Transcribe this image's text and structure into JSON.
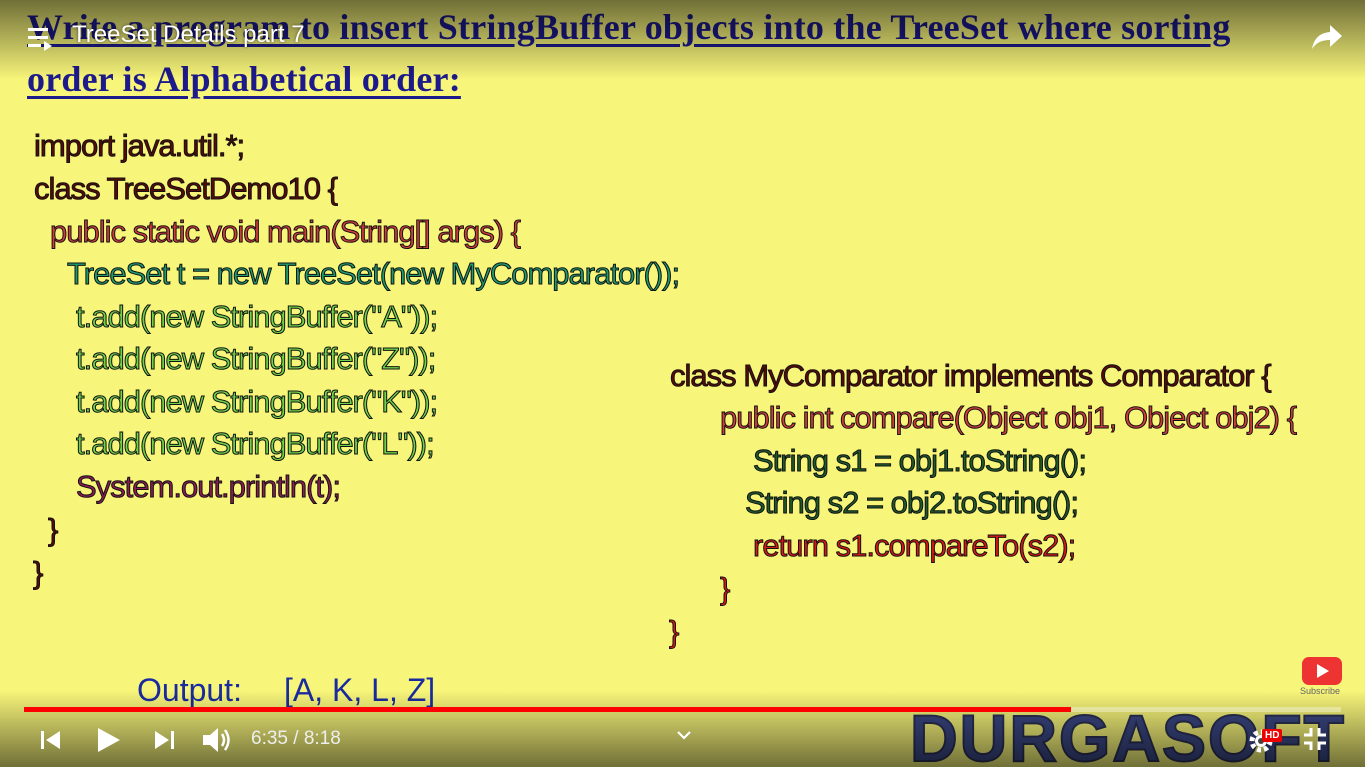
{
  "player": {
    "title": "TreeSet Details part 7",
    "progress_fraction": 0.795,
    "current_time": "6:35",
    "total_time": "8:18",
    "time_separator": "/",
    "hd_badge": "HD",
    "subscribe_label": "Subscribe",
    "watermark": "DURGASOFT"
  },
  "slide": {
    "heading_line1": "Write a program to insert StringBuffer objects into the TreeSet where sorting",
    "heading_line2": "order is Alphabetical order:",
    "left_code": [
      "import java.util.*;",
      "class TreeSetDemo10  {",
      "public static void main(String[] args) {",
      "TreeSet t = new TreeSet(new MyComparator());",
      "t.add(new StringBuffer(\"A\"));",
      "t.add(new StringBuffer(\"Z\"));",
      "t.add(new StringBuffer(\"K\"));",
      "t.add(new StringBuffer(\"L\"));",
      "System.out.println(t);",
      "}",
      "}"
    ],
    "right_code": [
      "class MyComparator implements Comparator  {",
      "public int compare(Object obj1, Object obj2) {",
      "String s1 = obj1.toString();",
      "String s2 = obj2.toString();",
      "return s1.compareTo(s2);",
      "}",
      "}"
    ],
    "output_label": "Output:",
    "output_value": "[A, K, L, Z]"
  }
}
